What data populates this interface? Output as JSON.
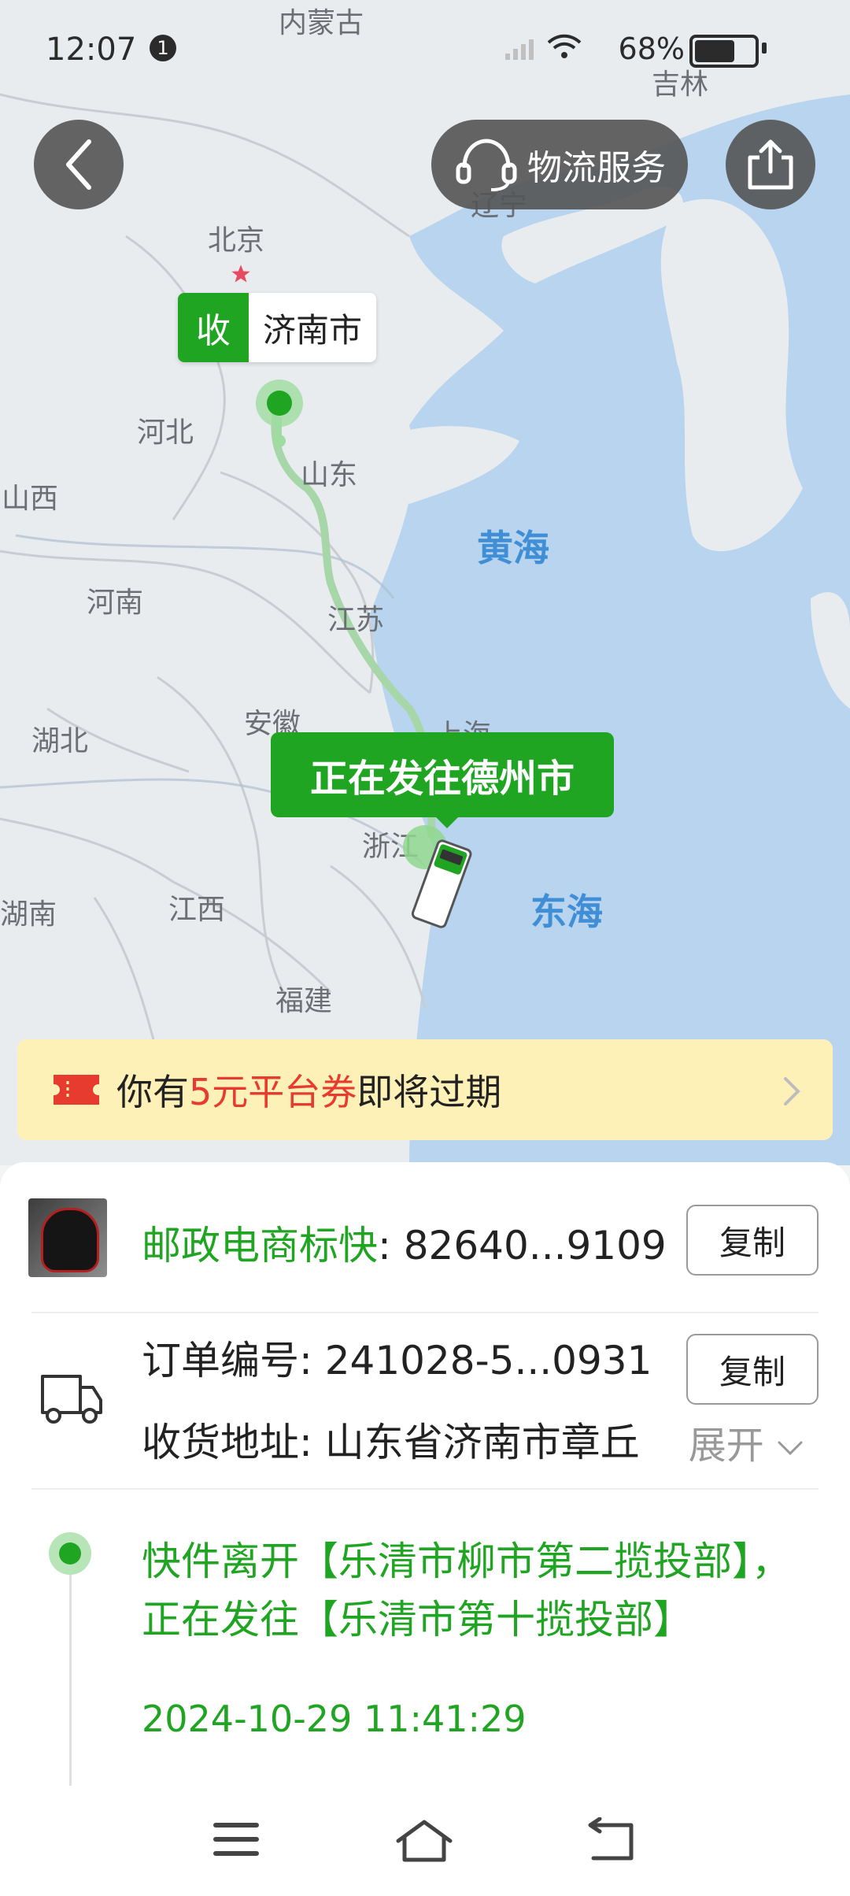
{
  "status_bar": {
    "time": "12:07",
    "notification_badge": "1",
    "battery": "68%",
    "battery_level": 0.68
  },
  "map": {
    "labels": {
      "neimenggu": "内蒙古",
      "jilin": "吉林",
      "liaoning": "辽宁",
      "beijing": "北京",
      "hebei": "河北",
      "shanxi": "山西",
      "shandong": "山东",
      "henan": "河南",
      "jiangsu": "江苏",
      "anhui": "安徽",
      "shanghai": "上海",
      "hubei": "湖北",
      "zhejiang": "浙江",
      "hunan": "湖南",
      "jiangxi": "江西",
      "fujian": "福建",
      "huanghai": "黄海",
      "donghai": "东海"
    },
    "receiver_badge": "收",
    "receiver_city": "济南市",
    "current_status": "正在发往德州市"
  },
  "toolbar": {
    "service_label": "物流服务"
  },
  "coupon": {
    "prefix": "你有",
    "highlight": "5元平台券",
    "suffix": "即将过期"
  },
  "shipment": {
    "carrier": "邮政电商标快",
    "tracking_number": ": 82640...9109",
    "copy_label": "复制",
    "order_label": "订单编号",
    "order_number": ": 241028-5...0931",
    "address_label": "收货地址",
    "address_value": ": 山东省济南市章丘",
    "expand_label": "展开"
  },
  "timeline": [
    {
      "event": "快件离开【乐清市柳市第二揽投部】，正在发往【乐清市第十揽投部】",
      "time": "2024-10-29 11:41:29"
    }
  ],
  "colors": {
    "accent_green": "#20a522",
    "coupon_red": "#e63b2e",
    "coupon_bg": "#fdf1b8"
  },
  "icons": {
    "back": "chevron-left-icon",
    "service": "headset-icon",
    "share": "share-icon",
    "coupon": "ticket-icon",
    "truck": "truck-icon",
    "nav": [
      "menu-icon",
      "home-icon",
      "back-icon"
    ]
  }
}
